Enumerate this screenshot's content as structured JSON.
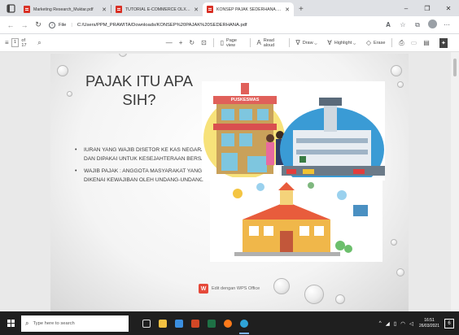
{
  "browser": {
    "tabs": [
      {
        "title": "Marketing Research_Muktar.pdf",
        "active": false
      },
      {
        "title": "TUTORIAL E-COMMERCE OLX.pdf",
        "active": false
      },
      {
        "title": "KONSEP PAJAK SEDERHANA.pdf",
        "active": true
      }
    ],
    "new_tab": "+",
    "window_controls": {
      "minimize": "–",
      "maximize": "❐",
      "close": "✕"
    },
    "address": {
      "scheme_label": "File",
      "url": "C:/Users/PPM_PRAWITA/Downloads/KONSEP%20PAJAK%20SEDERHANA.pdf"
    }
  },
  "pdf_toolbar": {
    "page_current": "1",
    "page_total": "of 17",
    "zoom_out": "—",
    "zoom_in": "+",
    "page_view": "Page view",
    "read_aloud": "Read aloud",
    "draw": "Draw",
    "highlight": "Highlight",
    "erase": "Erase"
  },
  "slide": {
    "title": "PAJAK ITU APA SIH?",
    "bullets": [
      "IURAN YANG WAJIB DISETOR KE KAS NEGARA DAN DIPAKAI UNTUK KESEJAHTERAAN BERSAMA",
      "WAJIB PAJAK : ANGGOTA MASYARAKAT YANG DIKENAI KEWAJIBAN OLEH UNDANG-UNDANG"
    ],
    "puskesmas_sign": "PUSKESMAS",
    "watermark": "Edit dengan WPS Office",
    "watermark_logo": "W"
  },
  "taskbar": {
    "search_placeholder": "Type here to search",
    "time": "16:51",
    "date": "26/03/2021",
    "notifications": "6"
  },
  "colors": {
    "pdf_red": "#d93025",
    "taskbar_bg": "#1f1f1f",
    "wps_red": "#e5493a"
  }
}
